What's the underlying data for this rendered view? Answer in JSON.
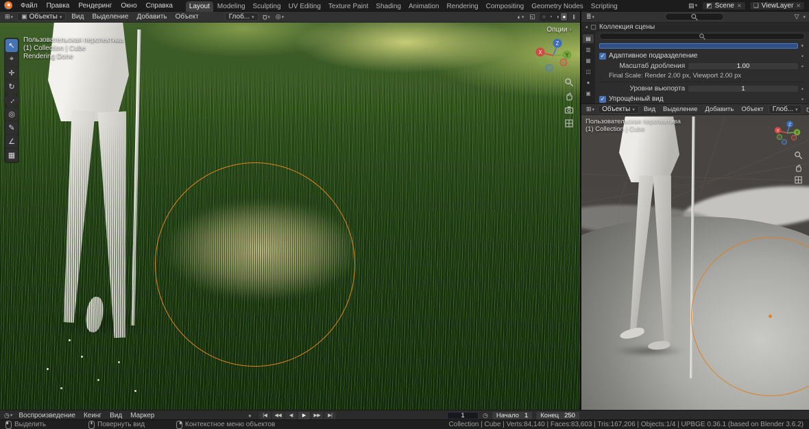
{
  "topbar": {
    "menus": [
      "Файл",
      "Правка",
      "Рендеринг",
      "Окно",
      "Справка"
    ],
    "workspaces": [
      "Layout",
      "Modeling",
      "Sculpting",
      "UV Editing",
      "Texture Paint",
      "Shading",
      "Animation",
      "Rendering",
      "Compositing",
      "Geometry Nodes",
      "Scripting"
    ],
    "active_workspace": "Layout",
    "scene_label": "Scene",
    "view_layer_label": "ViewLayer"
  },
  "viewport_header": {
    "mode": "Объекты",
    "menus": [
      "Вид",
      "Выделение",
      "Добавить",
      "Объект"
    ],
    "orientation": "Глоб...",
    "options": "Опции"
  },
  "tools": [
    {
      "name": "select-box",
      "glyph": "↖"
    },
    {
      "name": "cursor",
      "glyph": "⌖"
    },
    {
      "name": "move",
      "glyph": "✛"
    },
    {
      "name": "rotate",
      "glyph": "↻"
    },
    {
      "name": "scale",
      "glyph": "↔"
    },
    {
      "name": "transform",
      "glyph": "◎"
    },
    {
      "name": "annotate",
      "glyph": "✎"
    },
    {
      "name": "measure",
      "glyph": "∠"
    },
    {
      "name": "add-cube",
      "glyph": "▦"
    }
  ],
  "main_viewport": {
    "overlay": [
      "Пользовательская перспектива",
      "(1) Collection | Cube",
      "Rendering Done"
    ]
  },
  "outliner": {
    "item": "Коллекция сцены"
  },
  "prop_tabs": [
    {
      "name": "render",
      "glyph": "▤"
    },
    {
      "name": "output",
      "glyph": "▥"
    },
    {
      "name": "view-layer",
      "glyph": "▦"
    },
    {
      "name": "scene",
      "glyph": "◫"
    },
    {
      "name": "world",
      "glyph": "●"
    },
    {
      "name": "object",
      "glyph": "▣"
    }
  ],
  "properties": {
    "adaptive_subdivision": "Адаптивное подразделение",
    "dicing_scale_label": "Масштаб дробления",
    "dicing_scale_value": "1.00",
    "final_scale_info": "Final Scale: Render 2.00 px, Viewport 2.00 px",
    "viewport_levels_label": "Уровни вьюпорта",
    "viewport_levels_value": "1",
    "simplify": "Упрощённый вид"
  },
  "secondary_viewport": {
    "mode": "Объекты",
    "menus": [
      "Вид",
      "Выделение",
      "Добавить",
      "Объект"
    ],
    "orientation": "Глоб...",
    "overlay": [
      "Пользовательская перспектива",
      "(1) Collection | Cube"
    ]
  },
  "timeline": {
    "menus": [
      "Воспроизведение",
      "Кеинг",
      "Вид",
      "Маркер"
    ],
    "transport": [
      "|◀",
      "◀◀",
      "◀",
      "▶",
      "▶▶",
      "▶|"
    ],
    "current_frame": "1",
    "start_label": "Начало",
    "start_value": "1",
    "end_label": "Конец",
    "end_value": "250"
  },
  "statusbar": {
    "hints": [
      "Выделить",
      "Повернуть вид",
      "Контекстное меню объектов"
    ],
    "stats": "Collection | Cube | Verts:84,140 | Faces:83,603 | Tris:167,206 | Objects:1/4 | UPBGE 0.36.1 (based on Blender 3.6.2)"
  },
  "gizmo": {
    "x": "X",
    "y": "Y",
    "z": "Z"
  },
  "icons": {
    "dropdown": "▾",
    "editor_viewport": "⊞",
    "mode_object": "▣",
    "magnet": "Ω",
    "proportional": "◎",
    "overlays": "◐",
    "xray": "◱",
    "shading": [
      "○",
      "◔",
      "◑",
      "●"
    ],
    "pause": "‖",
    "editor_outliner": "≣",
    "filter": "▽",
    "collection": "▢",
    "editor_timeline": "◷",
    "record": "●",
    "clock": "◷",
    "check": "✓",
    "dot": "•",
    "close": "✕",
    "scene": "◩",
    "viewlayer": "❏",
    "screen_layout": "▤"
  },
  "colors": {
    "accent": "#4772b3",
    "selection": "#e8821e"
  }
}
